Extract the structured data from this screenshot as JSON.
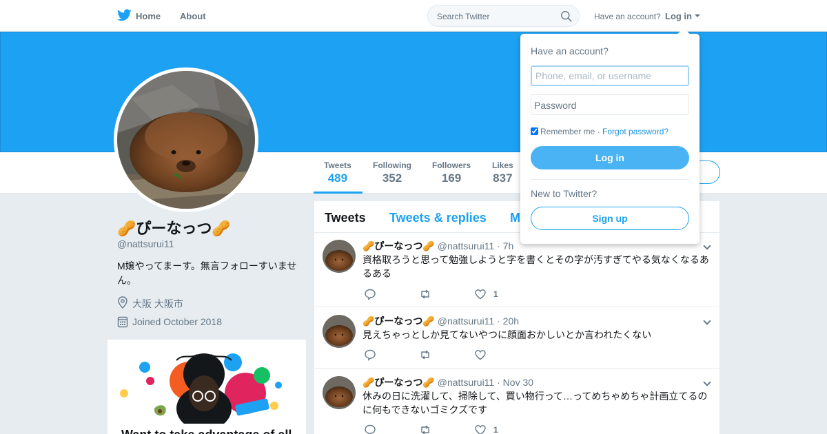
{
  "nav": {
    "home": "Home",
    "about": "About",
    "search_placeholder": "Search Twitter",
    "have_account": "Have an account?",
    "login": "Log in"
  },
  "colors": {
    "brand": "#1da1f2",
    "banner": "#1da1f2",
    "text": "#14171a",
    "muted": "#657786"
  },
  "profile": {
    "name": "🥜ぴーなっつ🥜",
    "handle": "@nattsurui11",
    "bio": "M嬢やってまーす。無言フォローすいません。",
    "location": "大阪 大阪市",
    "joined": "Joined October 2018",
    "location_icon": "location-pin-icon",
    "joined_icon": "calendar-icon"
  },
  "stats": [
    {
      "label": "Tweets",
      "value": "489"
    },
    {
      "label": "Following",
      "value": "352"
    },
    {
      "label": "Followers",
      "value": "169"
    },
    {
      "label": "Likes",
      "value": "837"
    }
  ],
  "promo": {
    "title": "Want to take advantage of all"
  },
  "timeline": {
    "tabs": [
      "Tweets",
      "Tweets & replies",
      "Media"
    ],
    "tweets": [
      {
        "name": "🥜ぴーなっつ🥜",
        "handle": "@nattsurui11",
        "time": "7h",
        "text": "資格取ろうと思って勉強しようと字を書くとその字が汚すぎてやる気なくなるあるある",
        "likes": "1"
      },
      {
        "name": "🥜ぴーなっつ🥜",
        "handle": "@nattsurui11",
        "time": "20h",
        "text": "見えちゃっとしか見てないやつに顔面おかしいとか言われたくない",
        "likes": ""
      },
      {
        "name": "🥜ぴーなっつ🥜",
        "handle": "@nattsurui11",
        "time": "Nov 30",
        "text": "休みの日に洗濯して、掃除して、買い物行って…ってめちゃめちゃ計画立てるのに何もできないゴミクズです",
        "likes": "1"
      }
    ]
  },
  "login_dropdown": {
    "title": "Have an account?",
    "username_placeholder": "Phone, email, or username",
    "password_label": "Password",
    "remember": "Remember me",
    "separator": " · ",
    "forgot": "Forgot password?",
    "login_button": "Log in",
    "new_to": "New to Twitter?",
    "signup_button": "Sign up"
  }
}
